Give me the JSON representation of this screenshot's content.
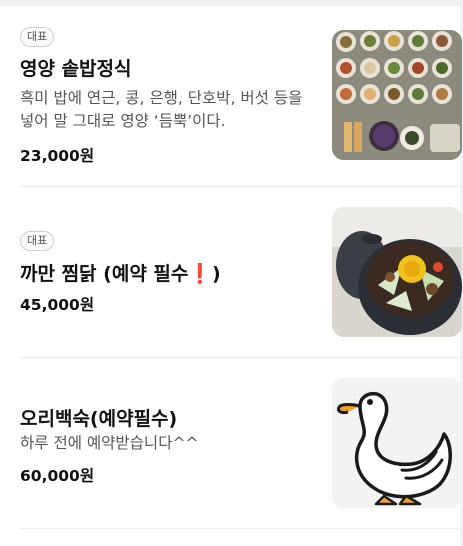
{
  "menu": {
    "items": [
      {
        "badge": "대표",
        "name": "영양 솥밥정식",
        "description": "흑미 밥에 연근, 콩, 은행, 단호박, 버섯 등을 넣어 말 그대로 영양 ‘듬뿍’이다.",
        "price": "23,000원",
        "image": "korean-set-meal-photo"
      },
      {
        "badge": "대표",
        "name": "까만 찜닭 (예약 필수",
        "name_emoji": "❗",
        "name_suffix": ")",
        "price": "45,000원",
        "image": "braised-chicken-pot-photo"
      },
      {
        "name": "오리백숙(예약필수)",
        "description": "하루 전에 예약받습니다^^",
        "price": "60,000원",
        "image": "duck-illustration"
      }
    ]
  },
  "colors": {
    "text_primary": "#111111",
    "text_secondary": "#555555",
    "divider": "#eeeeee",
    "accent_red": "#e03030"
  }
}
